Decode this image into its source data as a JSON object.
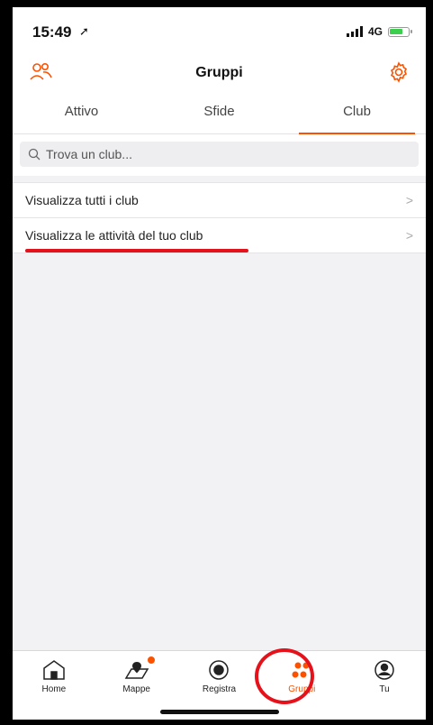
{
  "status_bar": {
    "time": "15:49",
    "network": "4G"
  },
  "header": {
    "title": "Gruppi",
    "left_icon": "friends-icon",
    "right_icon": "gear-icon"
  },
  "tabs": [
    {
      "label": "Attivo",
      "active": false
    },
    {
      "label": "Sfide",
      "active": false
    },
    {
      "label": "Club",
      "active": true
    }
  ],
  "search": {
    "placeholder": "Trova un club..."
  },
  "list": [
    {
      "label": "Visualizza tutti i club"
    },
    {
      "label": "Visualizza le attività del tuo club"
    }
  ],
  "tabbar": [
    {
      "label": "Home",
      "icon": "home-icon"
    },
    {
      "label": "Mappe",
      "icon": "map-icon",
      "badge": true
    },
    {
      "label": "Registra",
      "icon": "record-icon"
    },
    {
      "label": "Gruppi",
      "icon": "groups-icon",
      "active": true
    },
    {
      "label": "Tu",
      "icon": "profile-icon"
    }
  ],
  "colors": {
    "accent": "#fc5200",
    "annotation": "#e5121b"
  }
}
